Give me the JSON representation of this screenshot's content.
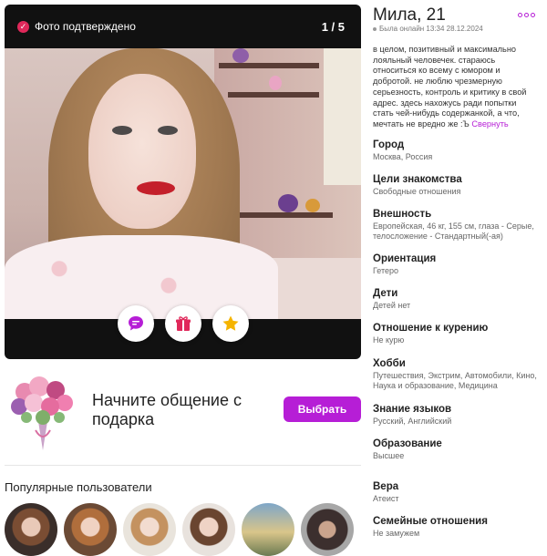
{
  "photo": {
    "verified_label": "Фото подтверждено",
    "counter": "1 / 5",
    "actions": [
      {
        "icon": "chat-icon",
        "color": "#b61ed6"
      },
      {
        "icon": "gift-icon",
        "color": "#e0285a"
      },
      {
        "icon": "star-icon",
        "color": "#f5b400"
      }
    ]
  },
  "gift_promo": {
    "text": "Начните общение с подарка",
    "button": "Выбрать"
  },
  "popular": {
    "title": "Популярные пользователи"
  },
  "profile": {
    "name": "Мила, 21",
    "last_seen": "Была онлайн 13:34 28.12.2024",
    "about": "в целом, позитивный и максимально лояльный человечек. стараюсь относиться ко всему с юмором и добротой. не люблю чрезмерную серьезность, контроль и критику в свой адрес. здесь нахожусь ради попытки стать чей-нибудь содержанкой, а что, мечтать не вредно же :Ъ",
    "collapse": "Свернуть",
    "fields": [
      {
        "label": "Город",
        "value": "Москва, Россия"
      },
      {
        "label": "Цели знакомства",
        "value": "Свободные отношения"
      },
      {
        "label": "Внешность",
        "value": "Европейская, 46 кг, 155 см, глаза - Серые, телосложение - Стандартный(-ая)"
      },
      {
        "label": "Ориентация",
        "value": "Гетеро"
      },
      {
        "label": "Дети",
        "value": "Детей нет"
      },
      {
        "label": "Отношение к курению",
        "value": "Не курю"
      },
      {
        "label": "Хобби",
        "value": "Путешествия, Экстрим, Автомобили, Кино, Наука и образование, Медицина"
      },
      {
        "label": "Знание языков",
        "value": "Русский, Английский"
      },
      {
        "label": "Образование",
        "value": "Высшее"
      },
      {
        "label": "Вера",
        "value": "Атеист"
      },
      {
        "label": "Семейные отношения",
        "value": "Не замужем"
      }
    ]
  },
  "colors": {
    "accent": "#b61ed6",
    "verified": "#e0285a"
  }
}
